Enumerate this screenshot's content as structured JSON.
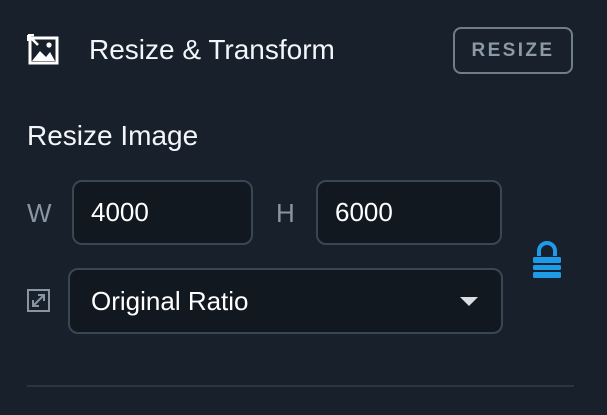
{
  "header": {
    "icon": "image-resize-icon",
    "title": "Resize & Transform",
    "action_label": "RESIZE"
  },
  "resize": {
    "section_title": "Resize Image",
    "width_label": "W",
    "width_value": "4000",
    "height_label": "H",
    "height_value": "6000",
    "ratio_icon": "expand-icon",
    "ratio_selected": "Original Ratio",
    "lock_icon": "lock-icon",
    "aspect_locked": true
  },
  "colors": {
    "background": "#18212b",
    "input_background": "#111820",
    "input_border": "#3b4654",
    "accent": "#1e9be8",
    "muted_text": "#8995a3",
    "button_border": "#6f7e8d"
  }
}
